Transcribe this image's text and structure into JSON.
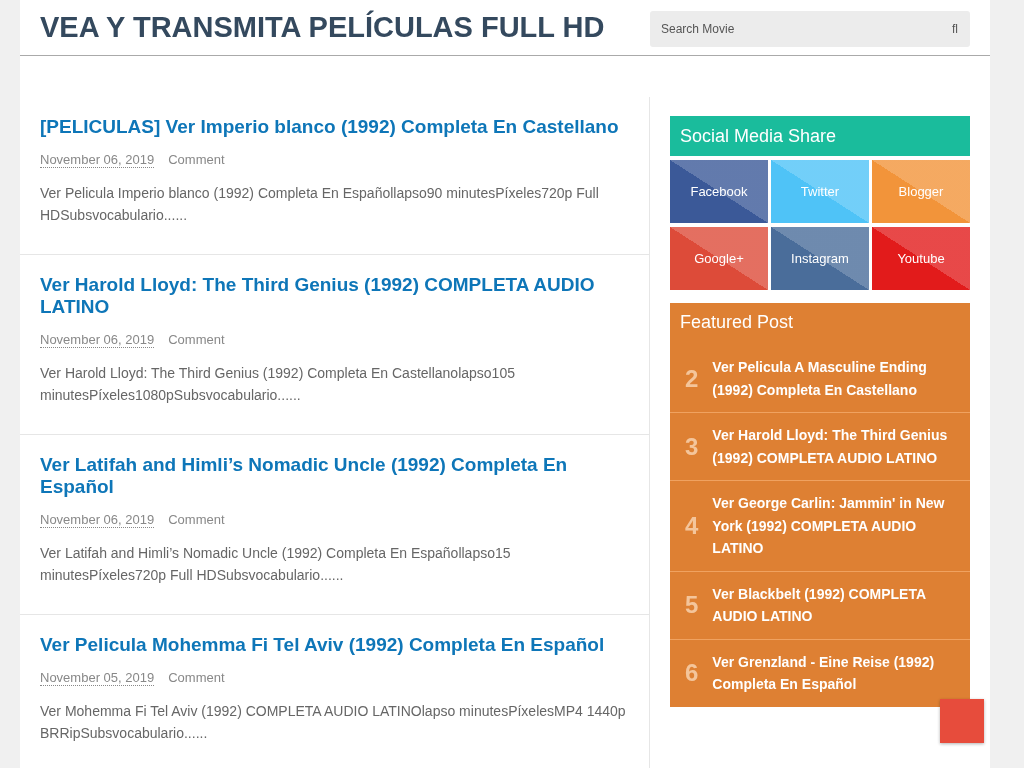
{
  "header": {
    "site_title": "VEA Y TRANSMITA PELÍCULAS FULL HD",
    "search": {
      "placeholder": "Search Movie",
      "button_glyph": "fl"
    }
  },
  "posts": [
    {
      "title": "[PELICULAS] Ver Imperio blanco (1992) Completa En Castellano",
      "date": "November 06, 2019",
      "comment": "Comment",
      "excerpt": "Ver Pelicula Imperio blanco (1992) Completa En Españollapso90 minutesPíxeles720p Full HDSubsvocabulario......"
    },
    {
      "title": "Ver Harold Lloyd: The Third Genius (1992) COMPLETA AUDIO LATINO",
      "date": "November 06, 2019",
      "comment": "Comment",
      "excerpt": "Ver Harold Lloyd: The Third Genius (1992) Completa En Castellanolapso105 minutesPíxeles1080pSubsvocabulario......"
    },
    {
      "title": "Ver Latifah and Himli’s Nomadic Uncle (1992) Completa En Español",
      "date": "November 06, 2019",
      "comment": "Comment",
      "excerpt": "Ver Latifah and Himli’s Nomadic Uncle (1992) Completa En Españollapso15 minutesPíxeles720p Full HDSubsvocabulario......"
    },
    {
      "title": "Ver Pelicula Mohemma Fi Tel Aviv (1992) Completa En Español",
      "date": "November 05, 2019",
      "comment": "Comment",
      "excerpt": "Ver Mohemma Fi Tel Aviv (1992) COMPLETA AUDIO LATINOlapso minutesPíxelesMP4 1440p BRRipSubsvocabulario......"
    }
  ],
  "social": {
    "title": "Social Media Share",
    "buttons": [
      {
        "label": "Facebook",
        "color": "#3b5998"
      },
      {
        "label": "Twitter",
        "color": "#4fc3f7"
      },
      {
        "label": "Blogger",
        "color": "#f2943a"
      },
      {
        "label": "Google+",
        "color": "#dd4b39"
      },
      {
        "label": "Instagram",
        "color": "#4a6d9a"
      },
      {
        "label": "Youtube",
        "color": "#e21b1b"
      }
    ]
  },
  "featured": {
    "title": "Featured Post",
    "items": [
      {
        "number": "2",
        "title": "Ver Pelicula A Masculine Ending (1992) Completa En Castellano"
      },
      {
        "number": "3",
        "title": "Ver Harold Lloyd: The Third Genius (1992) COMPLETA AUDIO LATINO"
      },
      {
        "number": "4",
        "title": "Ver George Carlin: Jammin' in New York (1992) COMPLETA AUDIO LATINO"
      },
      {
        "number": "5",
        "title": "Ver Blackbelt (1992) COMPLETA AUDIO LATINO"
      },
      {
        "number": "6",
        "title": "Ver Grenzland - Eine Reise (1992) Completa En Español"
      }
    ]
  }
}
